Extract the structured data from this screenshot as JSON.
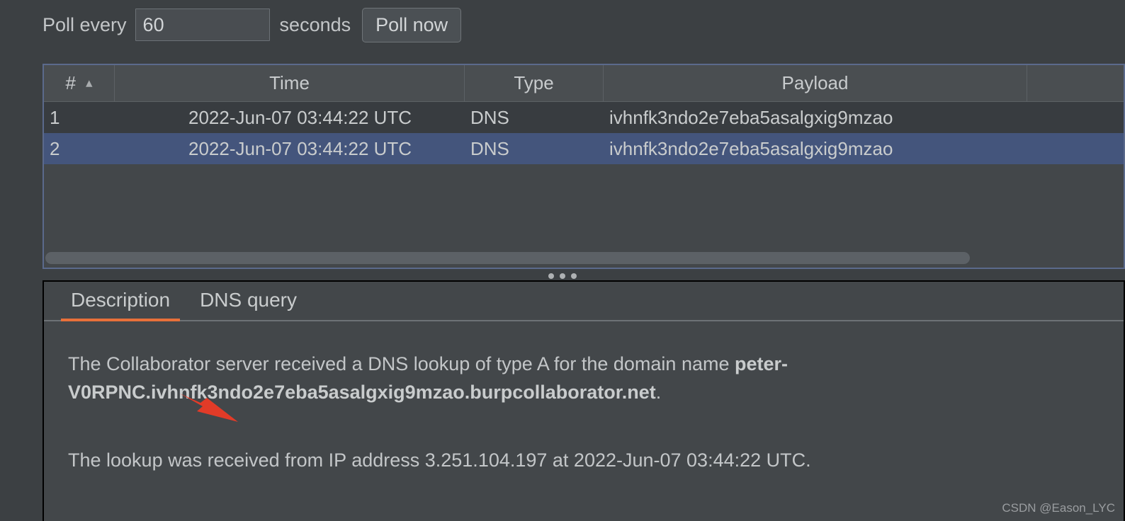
{
  "poll_bar": {
    "poll_every_label": "Poll every",
    "interval_value": "60",
    "interval_placeholder": "",
    "seconds_label": "seconds",
    "poll_now_label": "Poll now"
  },
  "table": {
    "columns": [
      {
        "label": "#",
        "sort": "ascending",
        "sort_icon": "chevron-up-icon"
      },
      {
        "label": "Time",
        "sort": "none",
        "sort_icon": ""
      },
      {
        "label": "Type",
        "sort": "none",
        "sort_icon": ""
      },
      {
        "label": "Payload",
        "sort": "none",
        "sort_icon": ""
      },
      {
        "label": "",
        "sort": "none",
        "sort_icon": ""
      }
    ],
    "rows": [
      {
        "num": "1",
        "time": "2022-Jun-07 03:44:22 UTC",
        "type": "DNS",
        "payload": "ivhnfk3ndo2e7eba5asalgxig9mzao",
        "selected": false
      },
      {
        "num": "2",
        "time": "2022-Jun-07 03:44:22 UTC",
        "type": "DNS",
        "payload": "ivhnfk3ndo2e7eba5asalgxig9mzao",
        "selected": true
      }
    ]
  },
  "detail": {
    "tabs": [
      {
        "label": "Description",
        "active": true
      },
      {
        "label": "DNS query",
        "active": false
      }
    ],
    "paragraph1": {
      "prefix": "The Collaborator server received a DNS lookup of type A for the domain name ",
      "domain": "peter-V0RPNC.ivhnfk3ndo2e7eba5asalgxig9mzao.burpcollaborator.net",
      "suffix": "."
    },
    "paragraph2": "The lookup was received from IP address 3.251.104.197 at 2022-Jun-07 03:44:22 UTC."
  },
  "colors": {
    "page_background": "#3c4043",
    "panel_background": "#43474a",
    "row_odd": "#383c40",
    "row_selected": "#44557c",
    "focus_border": "#5b6a8c",
    "accent_tab_underline": "#e8703a",
    "annotation_arrow": "#e23b28",
    "text": "#c3c6c8"
  },
  "watermark": "CSDN @Eason_LYC"
}
